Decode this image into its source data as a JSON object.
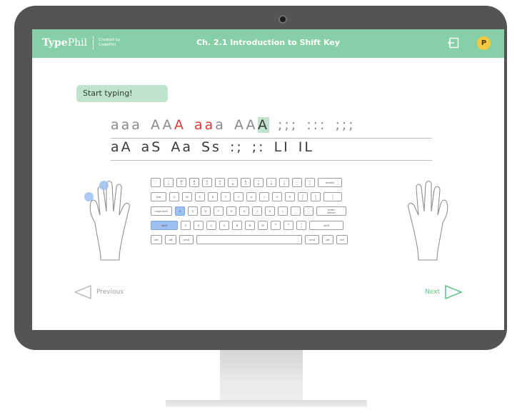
{
  "app": {
    "brand_type": "Type",
    "brand_phil": "Phil",
    "credit_line1": "Created by",
    "credit_line2": "CodePhil",
    "chapter_title": "Ch. 2.1 Introduction to Shift Key",
    "avatar_initial": "P"
  },
  "lesson": {
    "prompt": "Start typing!",
    "line1_words": [
      {
        "text": "aaa",
        "state": "typed"
      },
      {
        "text": "AA",
        "state": "typed",
        "suffix_err": "A"
      },
      {
        "text": "aa",
        "state": "error",
        "suffix": "a"
      },
      {
        "text": "AA",
        "state": "pending",
        "current": "A"
      },
      {
        "text": ";;;",
        "state": "pending"
      },
      {
        "text": ":::",
        "state": "pending"
      },
      {
        "text": ";;;",
        "state": "pending"
      }
    ],
    "line2_words": [
      "aA",
      "aS",
      "Aa",
      "Ss",
      ":;",
      ";:",
      "LI",
      "IL"
    ]
  },
  "keyboard": {
    "row1": [
      "~\n`",
      "!\n1",
      "@\n2",
      "#\n3",
      "$\n4",
      "%\n5",
      "^\n6",
      "&\n7",
      "*\n8",
      "(\n9",
      ")\n0",
      "_\n-",
      "+\n=",
      "delete"
    ],
    "row2": [
      "tab",
      "Q",
      "W",
      "E",
      "R",
      "T",
      "Y",
      "U",
      "I",
      "O",
      "P",
      "{\n[",
      "}\n]",
      "|\n\\"
    ],
    "row3": [
      "caps lock",
      "A",
      "S",
      "D",
      "F",
      "G",
      "H",
      "J",
      "K",
      "L",
      ":\n;",
      "\"\n'",
      "enter\nreturn"
    ],
    "row4": [
      "shift",
      "Z",
      "X",
      "C",
      "V",
      "B",
      "N",
      "M",
      "<\n,",
      ">\n.",
      "?\n/",
      "shift"
    ],
    "row5": [
      "ctrl",
      "alt",
      "cmd",
      "",
      "cmd",
      "alt",
      "ctrl"
    ],
    "highlighted": [
      "A",
      "shift-left"
    ]
  },
  "nav": {
    "previous_label": "Previous",
    "next_label": "Next"
  },
  "colors": {
    "accent": "#87cfa6",
    "error": "#d63a3a",
    "highlight_key": "#9dbff2",
    "avatar": "#f4c93d"
  }
}
